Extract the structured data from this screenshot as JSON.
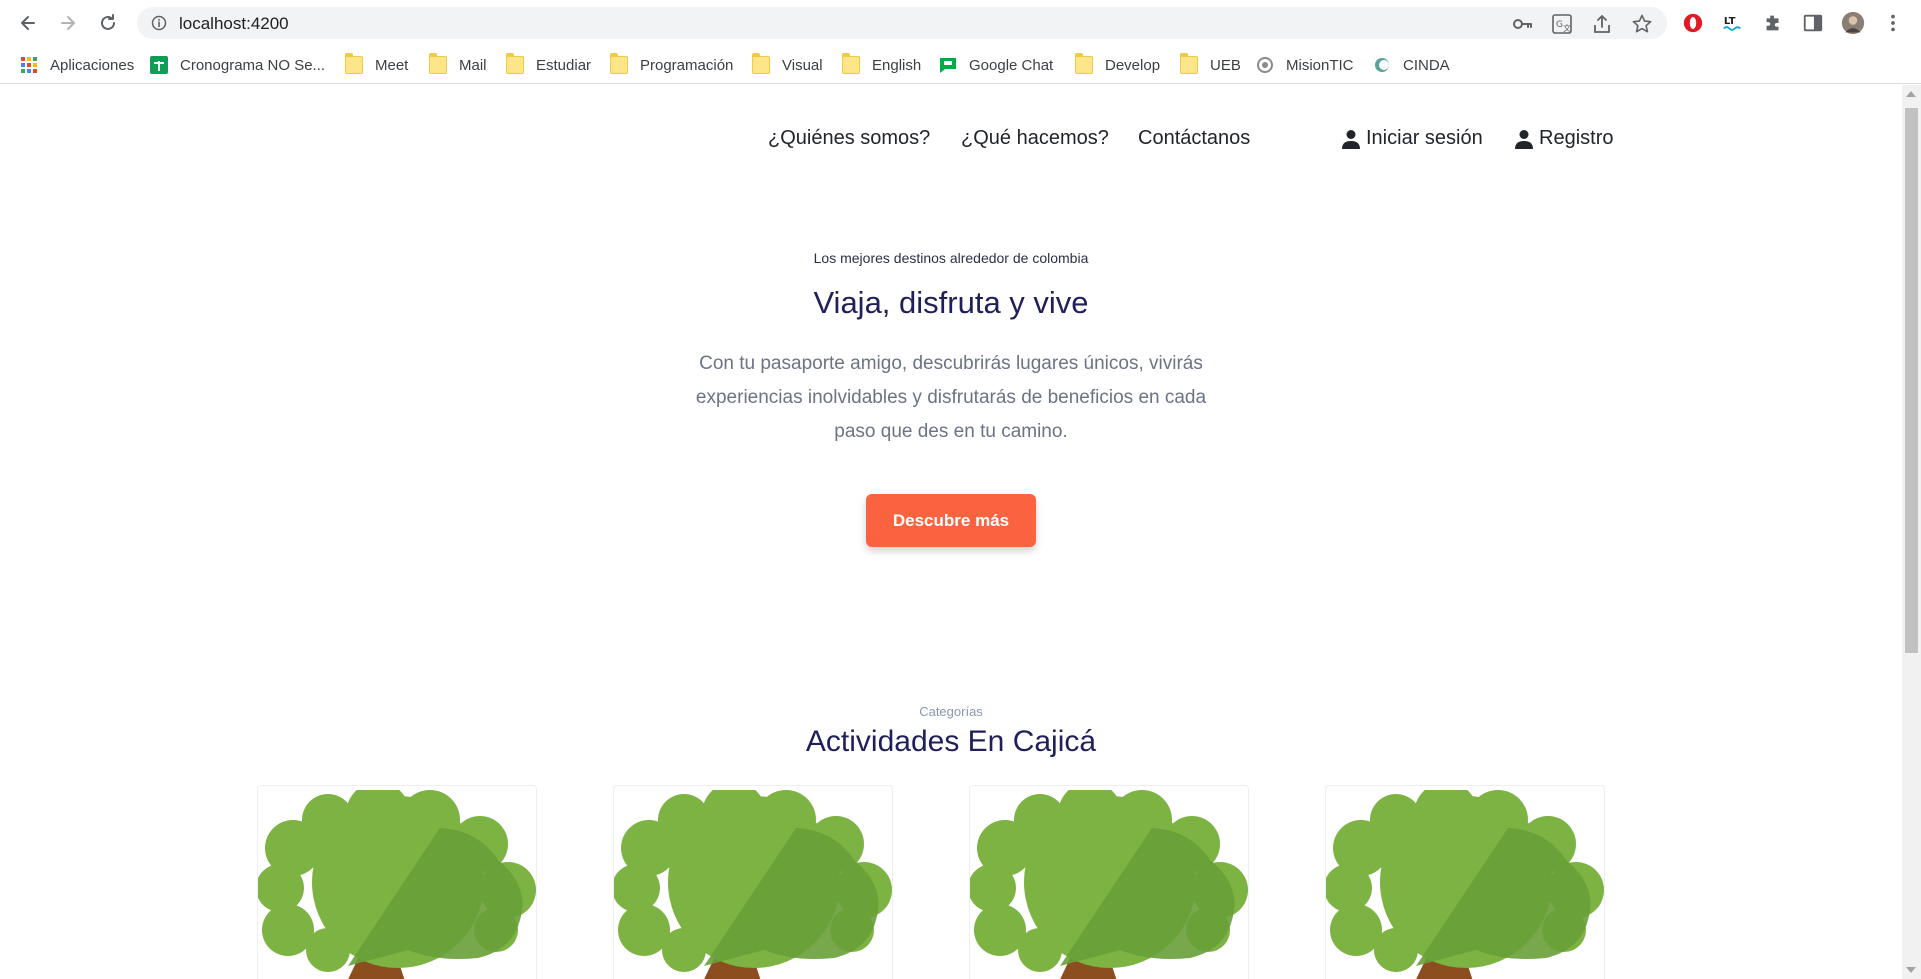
{
  "browser": {
    "url": "localhost:4200",
    "bookmarks": [
      {
        "label": "Aplicaciones",
        "icon": "apps-grid-icon"
      },
      {
        "label": "Cronograma NO Se...",
        "icon": "sheets-icon"
      },
      {
        "label": "Meet",
        "icon": "folder-icon"
      },
      {
        "label": "Mail",
        "icon": "folder-icon"
      },
      {
        "label": "Estudiar",
        "icon": "folder-icon"
      },
      {
        "label": "Programación",
        "icon": "folder-icon"
      },
      {
        "label": "Visual",
        "icon": "folder-icon"
      },
      {
        "label": "English",
        "icon": "folder-icon"
      },
      {
        "label": "Google Chat",
        "icon": "google-chat-icon"
      },
      {
        "label": "Develop",
        "icon": "folder-icon"
      },
      {
        "label": "UEB",
        "icon": "folder-icon"
      },
      {
        "label": "MisionTIC",
        "icon": "misiontic-icon"
      },
      {
        "label": "CINDA",
        "icon": "cinda-icon"
      }
    ]
  },
  "nav": {
    "quienes": "¿Quiénes somos?",
    "que": "¿Qué hacemos?",
    "contacto": "Contáctanos",
    "login": "Iniciar sesión",
    "registro": "Registro"
  },
  "hero": {
    "subtitle": "Los mejores destinos alrededor de colombia",
    "title": "Viaja, disfruta y vive",
    "text": "Con tu pasaporte amigo, descubrirás lugares únicos, vivirás experiencias inolvidables y disfrutarás de beneficios en cada paso que des en tu camino.",
    "cta": "Descubre más"
  },
  "categories": {
    "subtitle": "Categorías",
    "title": "Actividades En Cajicá",
    "card_count": 4
  },
  "colors": {
    "cta": "#fb6340",
    "heading": "#1f1f5a",
    "tree_light": "#7cb342",
    "tree_dark": "#689f38",
    "trunk": "#8d4e1f"
  }
}
